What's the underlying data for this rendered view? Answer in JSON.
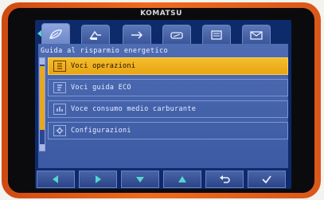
{
  "brand": "KOMATSU",
  "page": {
    "title": "Guida al risparmio energetico"
  },
  "tabs": [
    {
      "icon": "eco-leaf-icon",
      "active": true
    },
    {
      "icon": "excavator-icon",
      "active": false
    },
    {
      "icon": "fuel-arrow-icon",
      "active": false
    },
    {
      "icon": "speed-icon",
      "active": false
    },
    {
      "icon": "list-icon",
      "active": false
    },
    {
      "icon": "envelope-icon",
      "active": false
    }
  ],
  "menu": {
    "items": [
      {
        "label": "Voci operazioni",
        "icon": "document-icon",
        "selected": true
      },
      {
        "label": "Voci guida ECO",
        "icon": "eco-document-icon",
        "selected": false
      },
      {
        "label": "Voce consumo medio carburante",
        "icon": "fuel-chart-icon",
        "selected": false
      },
      {
        "label": "Configurazioni",
        "icon": "settings-gear-icon",
        "selected": false
      }
    ]
  },
  "softkeys": [
    {
      "name": "left",
      "icon": "triangle-left-icon"
    },
    {
      "name": "right",
      "icon": "triangle-right-icon"
    },
    {
      "name": "down",
      "icon": "triangle-down-icon"
    },
    {
      "name": "up",
      "icon": "triangle-up-icon"
    },
    {
      "name": "back",
      "icon": "return-icon"
    },
    {
      "name": "confirm",
      "icon": "check-icon"
    }
  ],
  "colors": {
    "bezel": "#e2601c",
    "screen": "#0d2a6b",
    "panel": "#4662ad",
    "selected": "#f0b323",
    "accent": "#56d5d0"
  }
}
